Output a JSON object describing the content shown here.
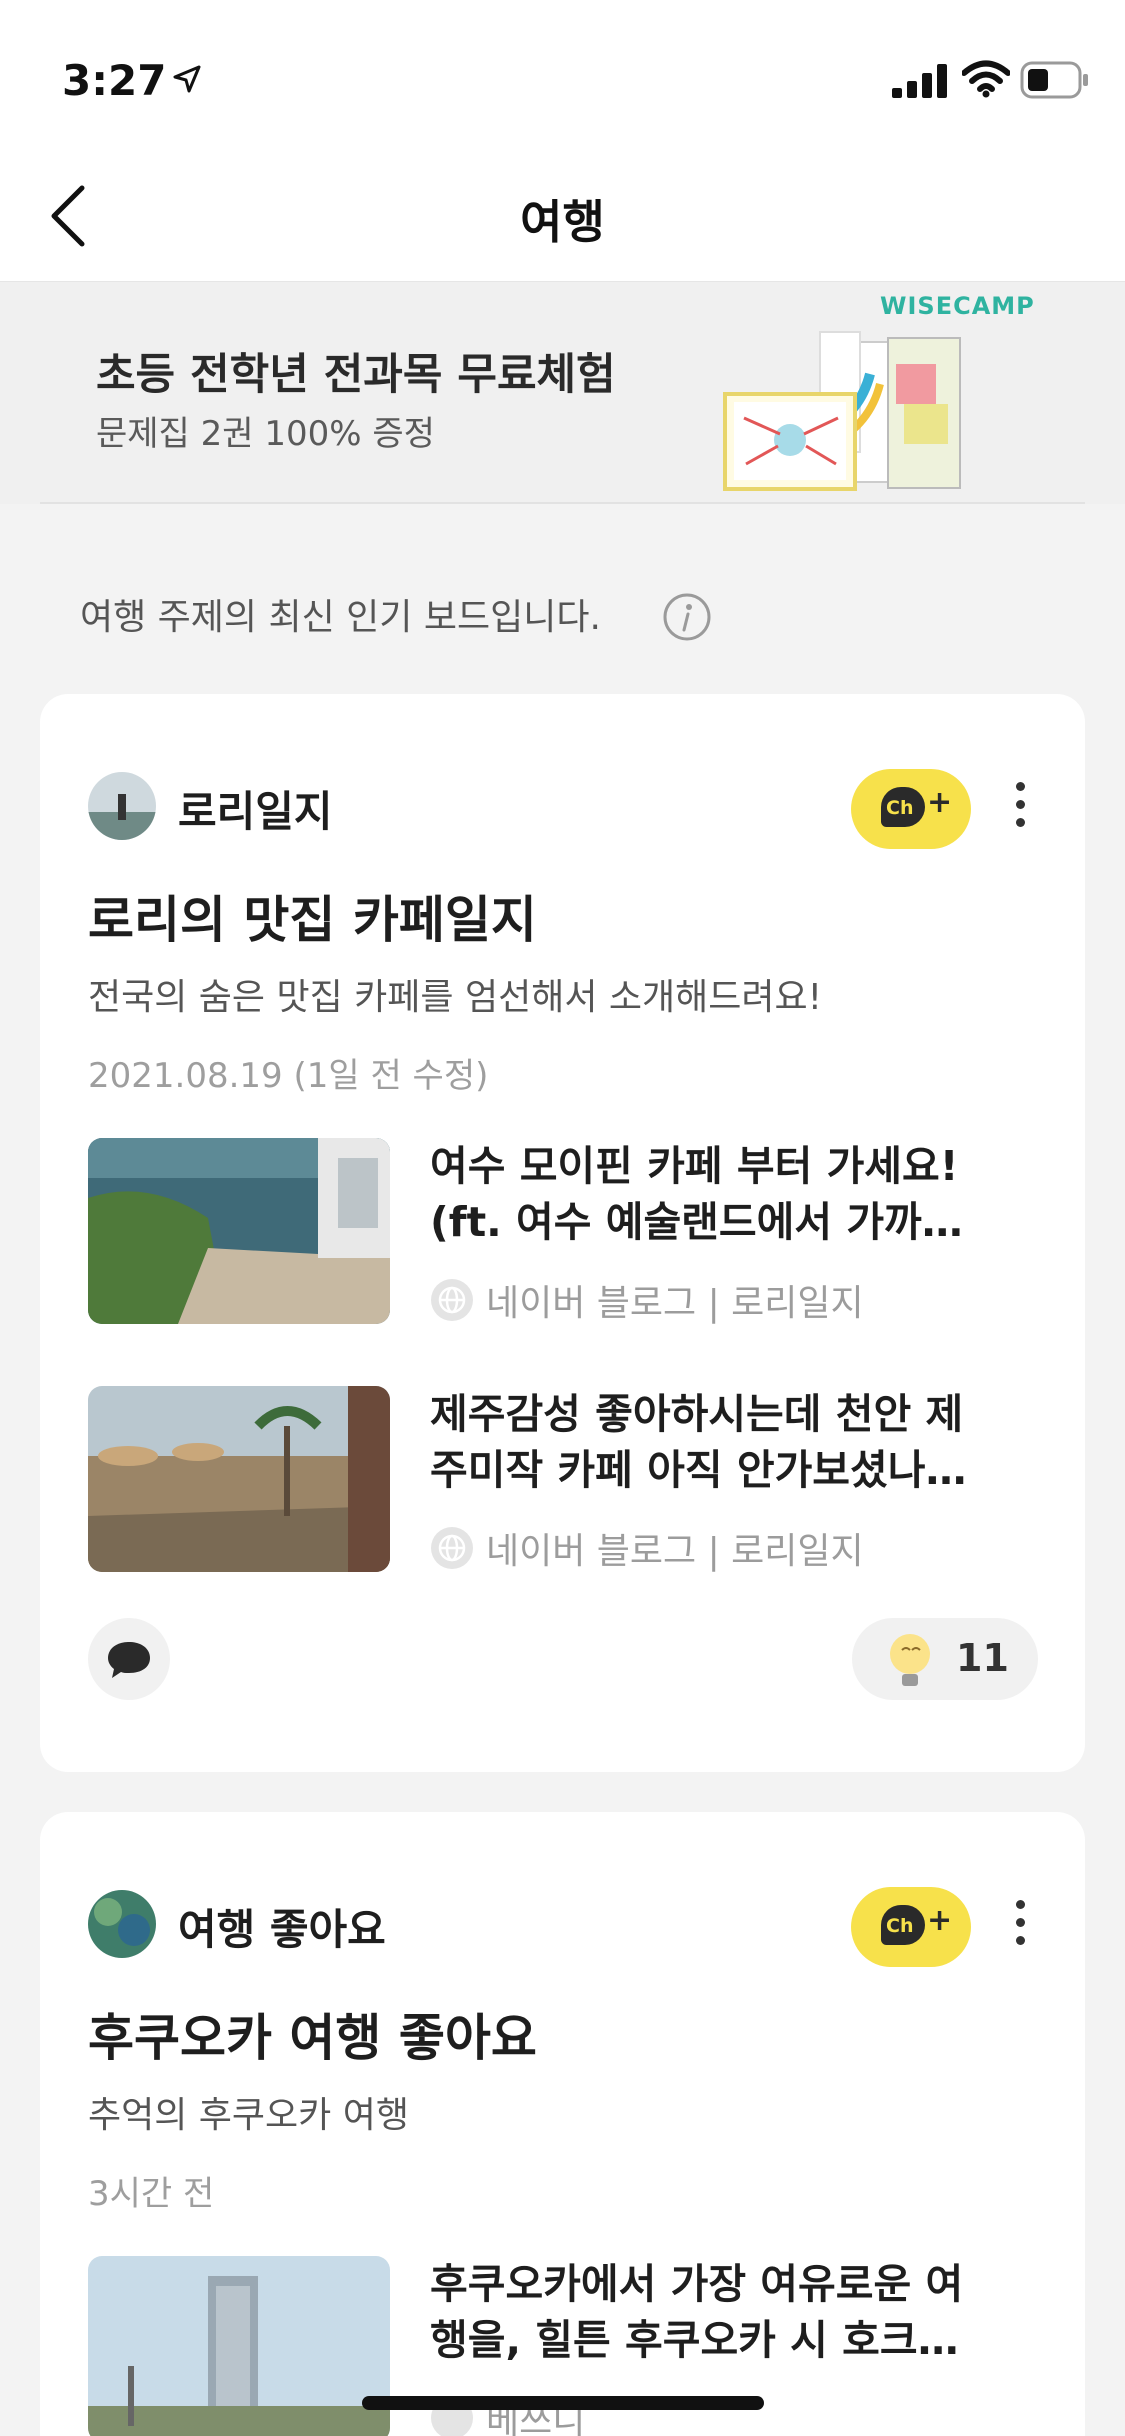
{
  "status_bar": {
    "time": "3:27"
  },
  "nav": {
    "title": "여행"
  },
  "banner": {
    "title": "초등 전학년 전과목 무료체험",
    "subtitle": "문제집 2권 100% 증정",
    "brand": "WISECAMP"
  },
  "section": {
    "description": "여행 주제의 최신 인기 보드입니다."
  },
  "boards": [
    {
      "channel_name": "로리일지",
      "title": "로리의 맛집 카페일지",
      "description": "전국의 숨은 맛집 카페를 엄선해서 소개해드려요!",
      "date": "2021.08.19 (1일 전 수정)",
      "posts": [
        {
          "title_line1": "여수 모이핀 카페 부터 가세요!",
          "title_line2": "(ft. 여수 예술랜드에서 가까…",
          "source": "네이버 블로그 | 로리일지"
        },
        {
          "title_line1": "제주감성 좋아하시는데 천안 제",
          "title_line2": "주미작 카페 아직 안가보셨나…",
          "source": "네이버 블로그 | 로리일지"
        }
      ],
      "like_count": "11"
    },
    {
      "channel_name": "여행 좋아요",
      "title": "후쿠오카 여행 좋아요",
      "description": "추억의 후쿠오카 여행",
      "date": "3시간 전",
      "posts": [
        {
          "title_line1": "후쿠오카에서 가장 여유로운 여",
          "title_line2": "행을, 힐튼 후쿠오카 시 호크…",
          "source": "베쓰니"
        }
      ]
    }
  ],
  "colors": {
    "accent_yellow": "#f7e14b",
    "brand_teal": "#2fb3a0"
  }
}
